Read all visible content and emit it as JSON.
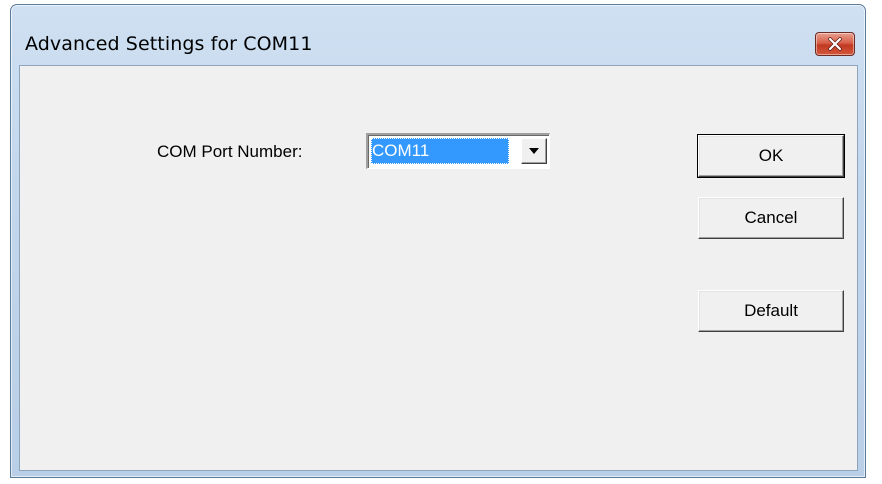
{
  "window": {
    "title": "Advanced Settings for COM11"
  },
  "form": {
    "com_port_label": "COM Port Number:",
    "com_port_value": "COM11"
  },
  "buttons": {
    "ok": "OK",
    "cancel": "Cancel",
    "default": "Default"
  },
  "icons": {
    "close": "close-icon",
    "dropdown": "chevron-down-icon"
  },
  "colors": {
    "selection": "#3399ff",
    "client_bg": "#f0f0f0",
    "close_button": "#c9452c"
  }
}
